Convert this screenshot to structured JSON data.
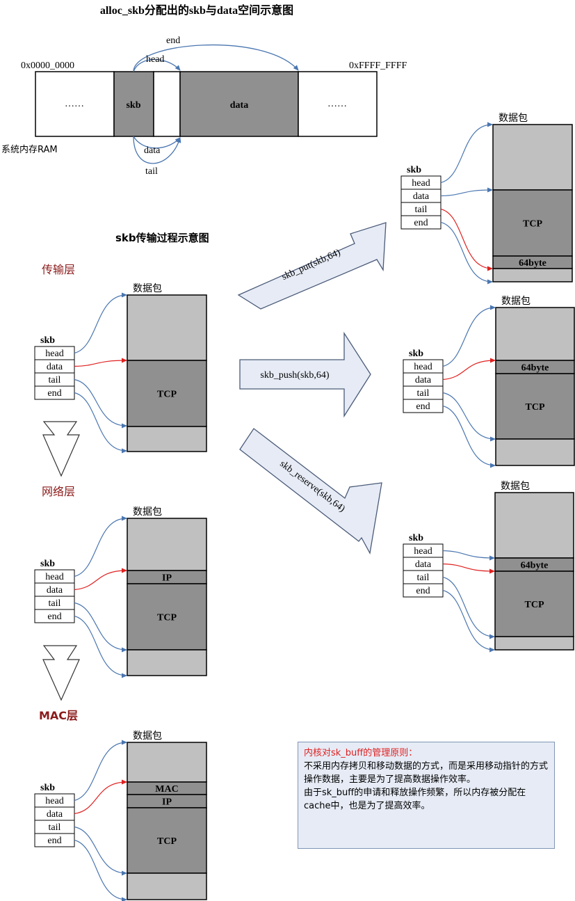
{
  "title": "alloc_skb分配出的skb与data空间示意图",
  "ram": {
    "start_addr": "0x0000_0000",
    "end_addr": "0xFFFF_FFFF",
    "label": "系统内存RAM",
    "cells": [
      "……",
      "skb",
      "",
      "data",
      "……"
    ],
    "arrows": [
      "end",
      "head",
      "data",
      "tail"
    ]
  },
  "process_title": "skb传输过程示意图",
  "packet_label": "数据包",
  "skb_label": "skb",
  "fields": [
    "head",
    "data",
    "tail",
    "end"
  ],
  "layers": [
    {
      "name": "传输层",
      "segments": [
        "",
        "TCP",
        ""
      ]
    },
    {
      "name": "网络层",
      "segments": [
        "",
        "IP",
        "TCP",
        ""
      ]
    },
    {
      "name": "MAC层",
      "segments": [
        "",
        "MAC",
        "IP",
        "TCP",
        ""
      ]
    }
  ],
  "operations": [
    {
      "label": "skb_put(skb,64)",
      "segments": [
        "",
        "TCP",
        "64byte",
        ""
      ]
    },
    {
      "label": "skb_push(skb,64)",
      "segments": [
        "",
        "64byte",
        "TCP",
        ""
      ]
    },
    {
      "label": "skb_reserve(skb,64)",
      "segments": [
        "",
        "64byte",
        "TCP",
        ""
      ]
    }
  ],
  "note": {
    "title": "内核对sk_buff的管理原则：",
    "para1": "不采用内存拷贝和移动数据的方式，而是采用移动指针的方式操作数据，主要是为了提高数据操作效率。",
    "para2": "由于sk_buff的申请和释放操作频繁，所以内存被分配在cache中，也是为了提高效率。"
  },
  "colors": {
    "light": "#c0c0c0",
    "dark": "#909090",
    "arrow_fill": "#e6ebf5",
    "arrow_stroke": "#4a5a78",
    "blue": "#4a76b0",
    "red": "#e02020",
    "layer_title": "#8b1a1a"
  }
}
